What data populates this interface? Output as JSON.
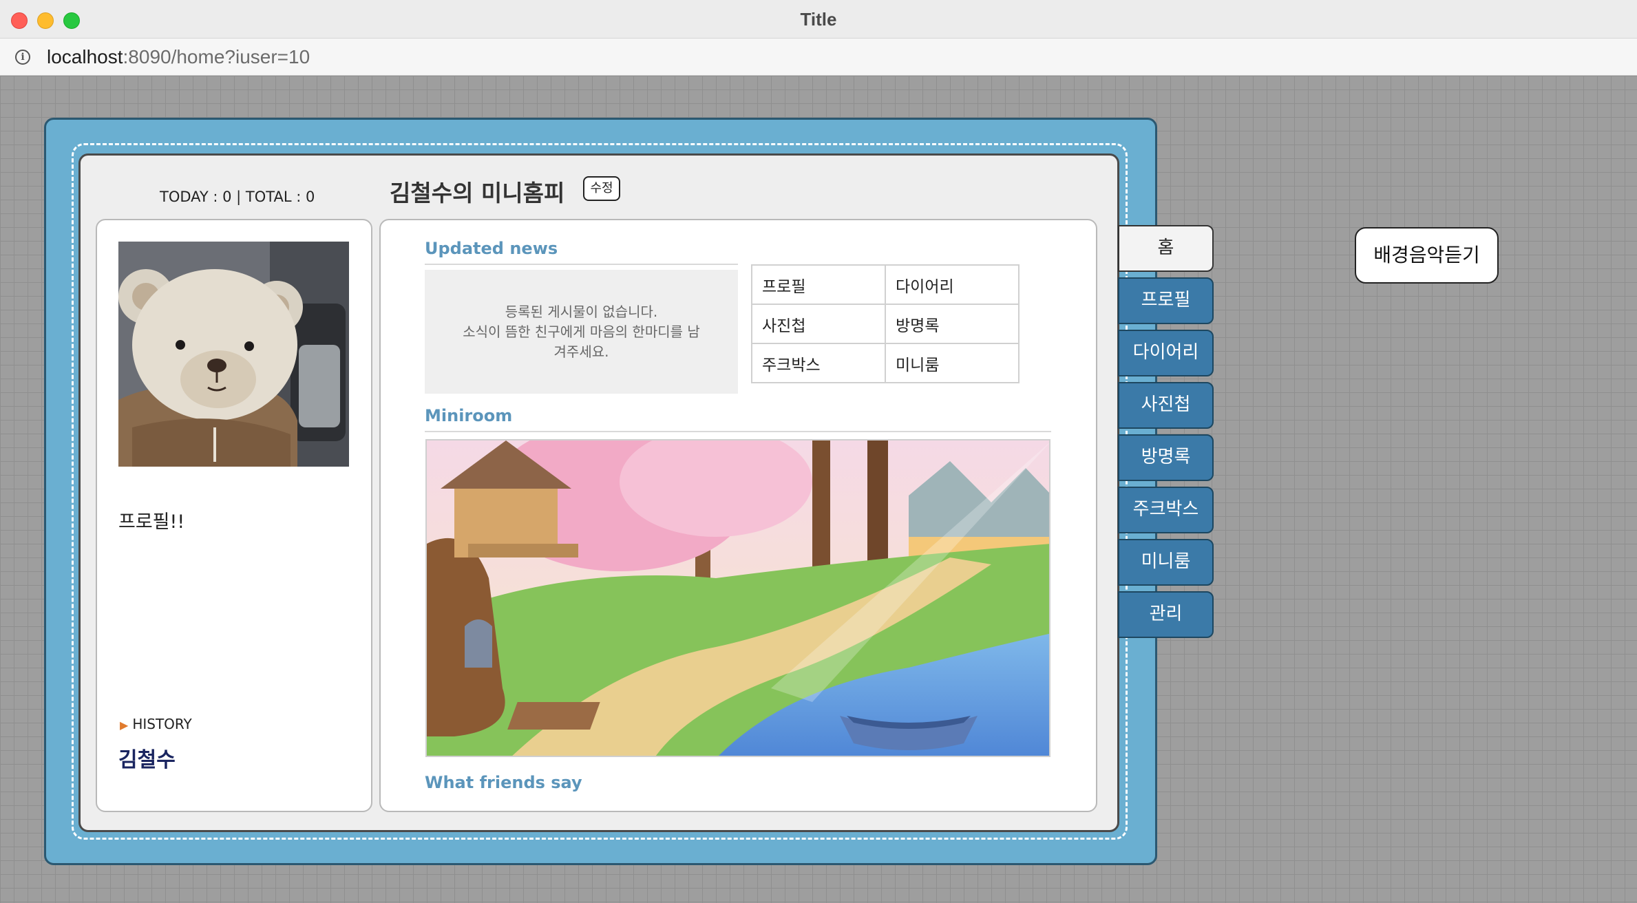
{
  "window": {
    "title": "Title"
  },
  "address": {
    "host": "localhost",
    "rest": ":8090/home?iuser=10"
  },
  "header": {
    "counter": "TODAY : 0 | TOTAL : 0",
    "title": "김철수의 미니홈피",
    "edit_label": "수정"
  },
  "profile": {
    "text": "프로필!!",
    "history_label": "HISTORY",
    "name": "김철수"
  },
  "news": {
    "title": "Updated news",
    "empty_message": "등록된 게시물이 없습니다.\n소식이 뜸한 친구에게 마음의 한마디를 남\n겨주세요."
  },
  "menu_grid": [
    [
      "프로필",
      "다이어리"
    ],
    [
      "사진첩",
      "방명록"
    ],
    [
      "주크박스",
      "미니룸"
    ]
  ],
  "miniroom": {
    "title": "Miniroom"
  },
  "friends": {
    "title": "What friends say"
  },
  "tabs": [
    {
      "label": "홈",
      "active": true
    },
    {
      "label": "프로필",
      "active": false
    },
    {
      "label": "다이어리",
      "active": false
    },
    {
      "label": "사진첩",
      "active": false
    },
    {
      "label": "방명록",
      "active": false
    },
    {
      "label": "주크박스",
      "active": false
    },
    {
      "label": "미니룸",
      "active": false
    },
    {
      "label": "관리",
      "active": false
    }
  ],
  "bgm_button": "배경음악듣기",
  "colors": {
    "book_blue": "#6aafd1",
    "tab_blue": "#3b7aa8",
    "section_title": "#5b95bb",
    "owner_name": "#1a2560"
  }
}
